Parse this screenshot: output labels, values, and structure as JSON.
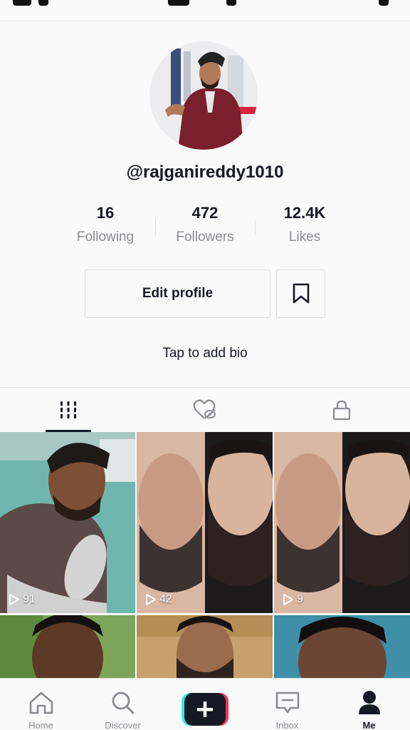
{
  "profile": {
    "username": "@rajganireddy1010",
    "bio_prompt": "Tap to add bio"
  },
  "stats": [
    {
      "value": "16",
      "label": "Following"
    },
    {
      "value": "472",
      "label": "Followers"
    },
    {
      "value": "12.4K",
      "label": "Likes"
    }
  ],
  "actions": {
    "edit_profile": "Edit profile"
  },
  "tabs": [
    {
      "icon": "grid-icon",
      "active": true
    },
    {
      "icon": "liked-hidden-icon",
      "active": false
    },
    {
      "icon": "lock-icon",
      "active": false
    }
  ],
  "videos": [
    {
      "views": "91"
    },
    {
      "views": "42"
    },
    {
      "views": "9"
    }
  ],
  "nav": {
    "home": "Home",
    "discover": "Discover",
    "inbox": "Inbox",
    "me": "Me"
  },
  "colors": {
    "text": "#161823",
    "muted": "#8a8b91",
    "accent_cyan": "#25f4ee",
    "accent_pink": "#fe2c55"
  }
}
